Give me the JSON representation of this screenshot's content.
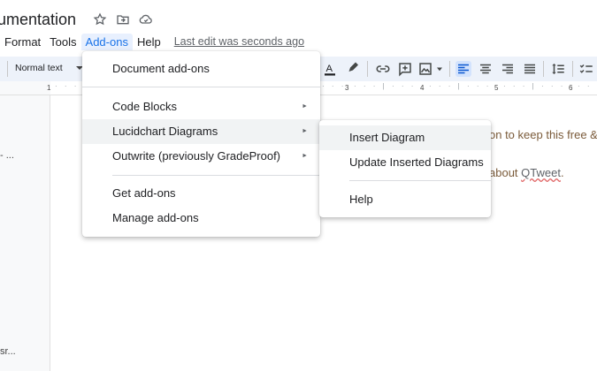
{
  "title": "umentation",
  "menubar": {
    "items": [
      "Format",
      "Tools",
      "Add-ons",
      "Help"
    ],
    "last_edit": "Last edit was seconds ago"
  },
  "toolbar": {
    "style": "Normal text"
  },
  "ruler": {
    "numbers": [
      "1",
      "3",
      "4",
      "5",
      "6"
    ]
  },
  "gutter": {
    "top": "- ...",
    "bottom": "sr..."
  },
  "document": {
    "line1": "on to keep this free &",
    "line2_prefix": "about ",
    "line2_word": "QTweet",
    "line2_suffix": "."
  },
  "addons_menu": {
    "items": [
      "Document add-ons",
      "Code Blocks",
      "Lucidchart Diagrams",
      "Outwrite (previously GradeProof)",
      "Get add-ons",
      "Manage add-ons"
    ],
    "arrow": "►"
  },
  "lucid_submenu": {
    "items": [
      "Insert Diagram",
      "Update Inserted Diagrams",
      "Help"
    ]
  },
  "colors": {
    "accent": "#1a73e8",
    "toolbar_bg": "#edf2fa",
    "highlight": "#f1f3f4"
  }
}
